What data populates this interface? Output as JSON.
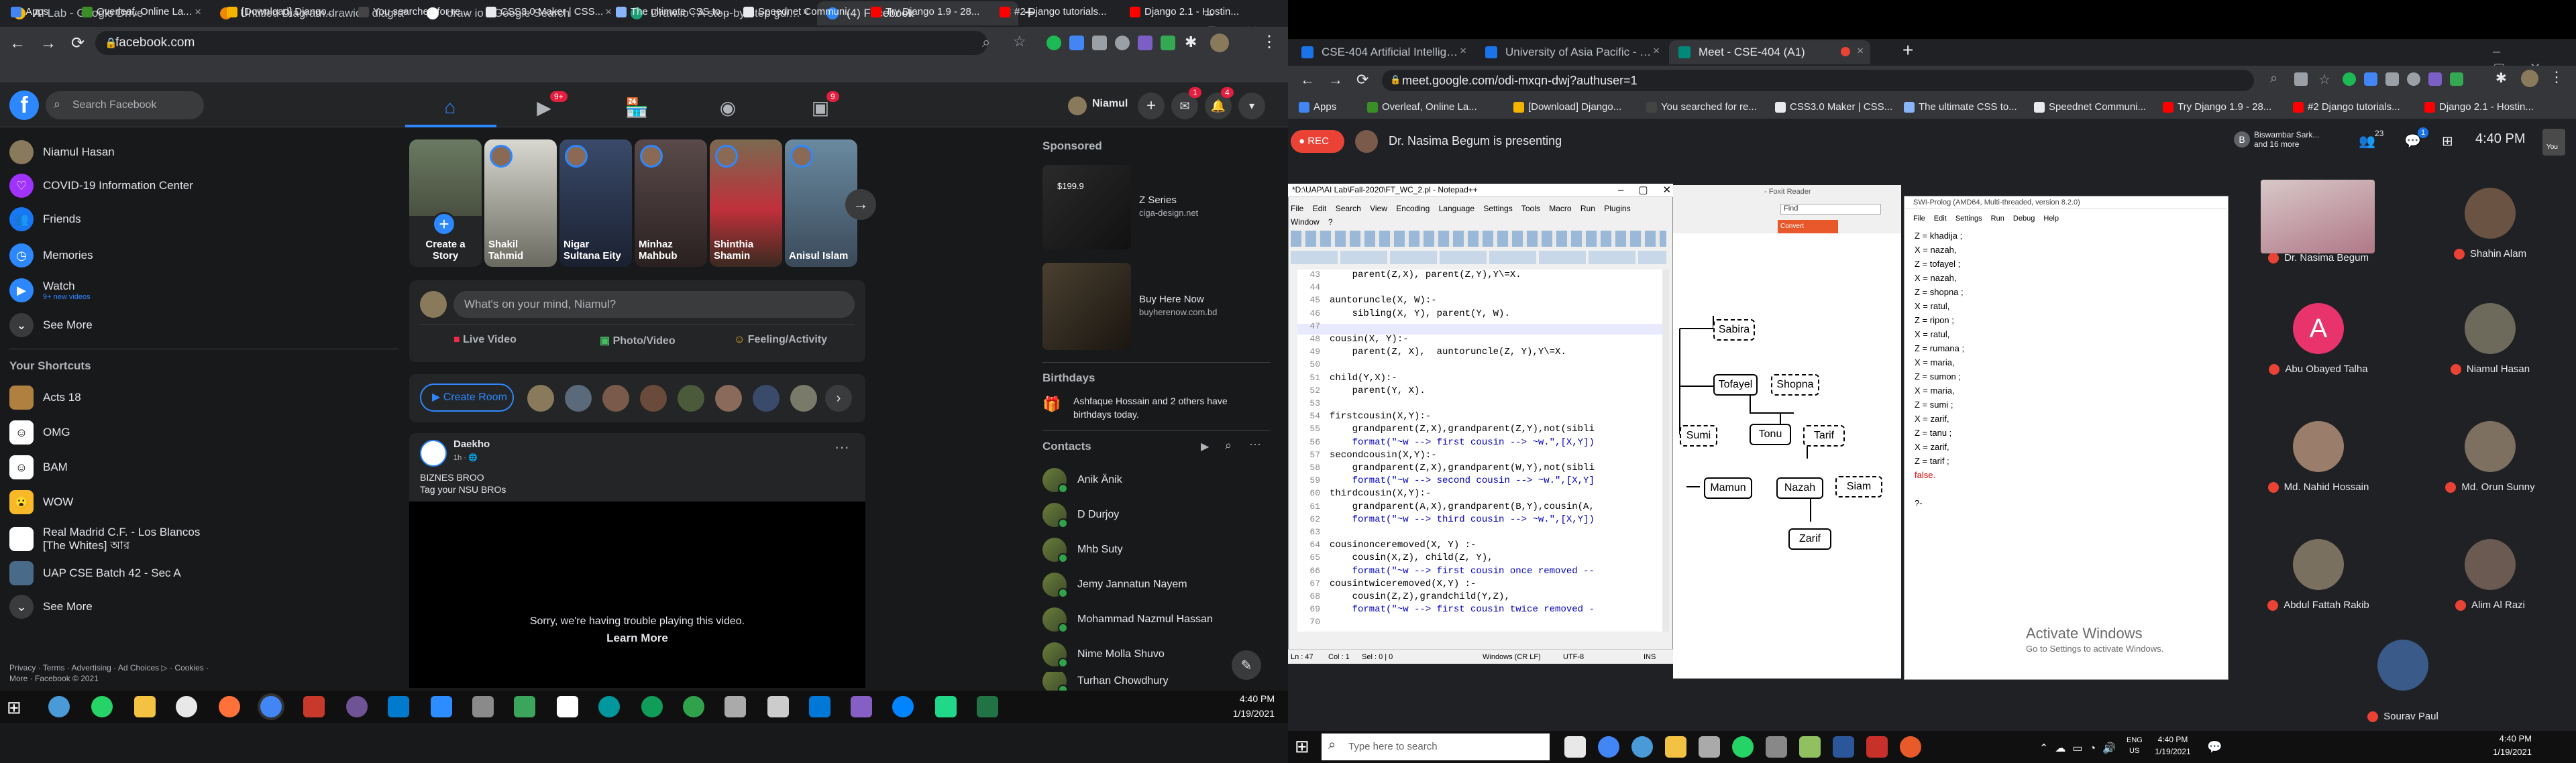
{
  "left": {
    "tabs": [
      {
        "label": "AI Lab - Google Drive",
        "active": false
      },
      {
        "label": "Untitled Diagram.drawio - diagra",
        "active": false
      },
      {
        "label": "draw io - Google Search",
        "active": false
      },
      {
        "label": "Draw.io : A step-by-step guide o",
        "active": false
      },
      {
        "label": "(4) Facebook",
        "active": true
      }
    ],
    "url": "facebook.com",
    "bookmarks": [
      "Apps",
      "Overleaf, Online La...",
      "[Download] Django...",
      "You searched for re...",
      "CSS3.0 Maker | CSS...",
      "The ultimate CSS to...",
      "Speednet Communi...",
      "Try Django 1.9 - 28...",
      "#2 Django tutorials...",
      "Django 2.1 - Hostin..."
    ],
    "fb": {
      "search_placeholder": "Search Facebook",
      "profile_name": "Niamul",
      "nav_badges": {
        "watch": "9+",
        "notifications": "4",
        "messenger": "1",
        "groups": "9"
      },
      "sidebar": [
        {
          "label": "Niamul Hasan"
        },
        {
          "label": "COVID-19 Information Center"
        },
        {
          "label": "Friends"
        },
        {
          "label": "Memories"
        },
        {
          "label": "Watch",
          "sub": "9+ new videos"
        },
        {
          "label": "See More"
        }
      ],
      "shortcuts_title": "Your Shortcuts",
      "shortcuts": [
        {
          "label": "Acts 18"
        },
        {
          "label": "OMG"
        },
        {
          "label": "BAM"
        },
        {
          "label": "WOW"
        },
        {
          "label": "Real Madrid C.F. - Los Blancos [The Whites] আর"
        },
        {
          "label": "UAP CSE Batch 42 - Sec A"
        },
        {
          "label": "See More"
        }
      ],
      "footer": "Privacy · Terms · Advertising · Ad Choices ▷ · Cookies · More · Facebook © 2021",
      "stories": [
        {
          "name": "Create a Story"
        },
        {
          "name": "Shakil Tahmid"
        },
        {
          "name": "Nigar Sultana Eity"
        },
        {
          "name": "Minhaz Mahbub"
        },
        {
          "name": "Shinthia Shamin"
        },
        {
          "name": "Anisul Islam"
        }
      ],
      "composer_placeholder": "What's on your mind, Niamul?",
      "composer_actions": [
        "Live Video",
        "Photo/Video",
        "Feeling/Activity"
      ],
      "create_room": "Create Room",
      "post": {
        "author": "Daekho",
        "meta": "1h · 🌐",
        "text1": "BIZNES BROO",
        "text2": "Tag your NSU BROs",
        "video_error": "Sorry, we're having trouble playing this video.",
        "learn_more": "Learn More"
      },
      "sponsored_title": "Sponsored",
      "ads": [
        {
          "title": "Z Series",
          "sub": "ciga-design.net",
          "price": "$199.9"
        },
        {
          "title": "Buy Here Now",
          "sub": "buyherenow.com.bd"
        }
      ],
      "birthdays_title": "Birthdays",
      "birthday_text": "Ashfaque Hossain and 2 others have birthdays today.",
      "contacts_title": "Contacts",
      "contacts": [
        "Anik Änik",
        "D Durjoy",
        "Mhb Suty",
        "Jemy Jannatun Nayem",
        "Mohammad Nazmul Hassan",
        "Nime Molla Shuvo",
        "Turhan Chowdhury"
      ]
    },
    "clock": {
      "time": "4:40 PM",
      "date": "1/19/2021"
    }
  },
  "right": {
    "tabs": [
      {
        "label": "CSE-404 Artificial Intelligence an",
        "active": false
      },
      {
        "label": "University of Asia Pacific - Calen",
        "active": false
      },
      {
        "label": "Meet - CSE-404 (A1)",
        "active": true
      }
    ],
    "url": "meet.google.com/odi-mxqn-dwj?authuser=1",
    "bookmarks": [
      "Apps",
      "Overleaf, Online La...",
      "[Download] Django...",
      "You searched for re...",
      "CSS3.0 Maker | CSS...",
      "The ultimate CSS to...",
      "Speednet Communi...",
      "Try Django 1.9 - 28...",
      "#2 Django tutorials...",
      "Django 2.1 - Hostin..."
    ],
    "meet": {
      "rec": "REC",
      "presenting": "Dr. Nasima Begum is presenting",
      "top_participants": "Biswambar Sark... and 16 more",
      "people_count": "23",
      "chat_badge": "1",
      "time": "4:40 PM",
      "you": "You",
      "participants": [
        {
          "name": "Dr. Nasima Begum",
          "color": "#7a5a4a"
        },
        {
          "name": "Shahin Alam",
          "color": "#6b5344"
        },
        {
          "name": "Abu Obayed Talha",
          "initial": "A",
          "color": "#e8336d"
        },
        {
          "name": "Niamul Hasan",
          "color": "#6d6a5c"
        },
        {
          "name": "Md. Nahid Hossain",
          "color": "#9a7d6a"
        },
        {
          "name": "Md. Orun Sunny",
          "color": "#7d7060"
        },
        {
          "name": "Abdul Fattah Rakib",
          "color": "#7a7060"
        },
        {
          "name": "Alim Al Razi",
          "color": "#6a5a52"
        },
        {
          "name": "Sourav Paul",
          "color": "#3a5a8a"
        }
      ],
      "activate": "Activate Windows",
      "activate_sub": "Go to Settings to activate Windows."
    },
    "notepad": {
      "title": "*D:\\UAP\\AI Lab\\Fall-2020\\FT_WC_2.pl - Notepad++",
      "menu": [
        "File",
        "Edit",
        "Search",
        "View",
        "Encoding",
        "Language",
        "Settings",
        "Tools",
        "Macro",
        "Run",
        "Plugins",
        "Window",
        "?"
      ],
      "lines": [
        {
          "n": "43",
          "t": "    parent(Z,X), parent(Z,Y),Y\\=X."
        },
        {
          "n": "44",
          "t": ""
        },
        {
          "n": "45",
          "t": "auntoruncle(X, W):-"
        },
        {
          "n": "46",
          "t": "    sibling(X, Y), parent(Y, W)."
        },
        {
          "n": "47",
          "t": ""
        },
        {
          "n": "48",
          "t": "cousin(X, Y):-"
        },
        {
          "n": "49",
          "t": "    parent(Z, X),  auntoruncle(Z, Y),Y\\=X."
        },
        {
          "n": "50",
          "t": ""
        },
        {
          "n": "51",
          "t": "child(Y,X):-"
        },
        {
          "n": "52",
          "t": "    parent(Y, X)."
        },
        {
          "n": "53",
          "t": ""
        },
        {
          "n": "54",
          "t": "firstcousin(X,Y):-"
        },
        {
          "n": "55",
          "t": "    grandparent(Z,X),grandparent(Z,Y),not(sibli"
        },
        {
          "n": "56",
          "t": "    format(\"~w --> first cousin --> ~w.\",[X,Y])"
        },
        {
          "n": "57",
          "t": "secondcousin(X,Y):-"
        },
        {
          "n": "58",
          "t": "    grandparent(Z,X),grandparent(W,Y),not(sibli"
        },
        {
          "n": "59",
          "t": "    format(\"~w --> second cousin --> ~w.\",[X,Y]"
        },
        {
          "n": "60",
          "t": "thirdcousin(X,Y):-"
        },
        {
          "n": "61",
          "t": "    grandparent(A,X),grandparent(B,Y),cousin(A,"
        },
        {
          "n": "62",
          "t": "    format(\"~w --> third cousin --> ~w.\",[X,Y])"
        },
        {
          "n": "63",
          "t": ""
        },
        {
          "n": "64",
          "t": "cousinonceremoved(X, Y) :-"
        },
        {
          "n": "65",
          "t": "    cousin(X,Z), child(Z, Y),"
        },
        {
          "n": "66",
          "t": "    format(\"~w --> first cousin once removed --"
        },
        {
          "n": "67",
          "t": "cousintwiceremoved(X,Y) :-"
        },
        {
          "n": "68",
          "t": "    cousin(Z,Z),grandchild(Y,Z),"
        },
        {
          "n": "69",
          "t": "    format(\"~w --> first cousin twice removed -"
        },
        {
          "n": "70",
          "t": ""
        }
      ],
      "status": [
        "Ln : 47",
        "Col : 1",
        "Sel : 0 | 0",
        "Windows (CR LF)",
        "UTF-8",
        "INS"
      ]
    },
    "drawio": {
      "title": "- Foxit Reader",
      "find": "Find",
      "nodes": [
        "Sabira",
        "Tofayel",
        "Shopna",
        "Sumi",
        "Tonu",
        "Tarif",
        "Mamun",
        "Nazah",
        "Siam",
        "Zarif"
      ]
    },
    "swipl": {
      "title": "SWI-Prolog (AMD64, Multi-threaded, version 8.2.0)",
      "menu": [
        "File",
        "Edit",
        "Settings",
        "Run",
        "Debug",
        "Help"
      ],
      "lines": [
        "Z = khadija ;",
        "X = nazah,",
        "Z = tofayel ;",
        "X = nazah,",
        "Z = shopna ;",
        "X = ratul,",
        "Z = ripon ;",
        "X = ratul,",
        "Z = rumana ;",
        "X = maria,",
        "Z = sumon ;",
        "X = maria,",
        "Z = sumi ;",
        "X = zarif,",
        "Z = tanu ;",
        "X = zarif,",
        "Z = tarif ;",
        "false.",
        "",
        "?-"
      ]
    },
    "taskbar": {
      "search": "Type here to search",
      "lang": "ENG",
      "region": "US",
      "time": "4:40 PM",
      "date": "1/19/2021"
    }
  },
  "colors": {
    "fb_blue": "#2d88ff",
    "rec_red": "#ea4335",
    "chrome_dark": "#202124"
  }
}
